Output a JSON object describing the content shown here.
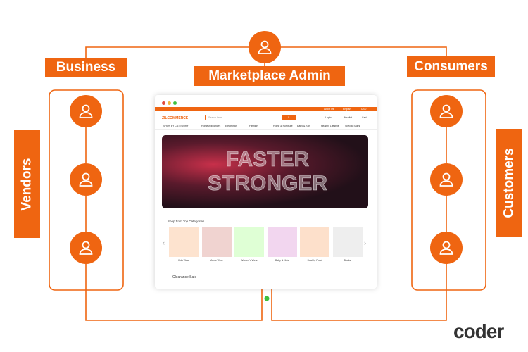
{
  "labels": {
    "business": "Business",
    "admin": "Marketplace Admin",
    "consumers": "Consumers",
    "vendors": "Vendors",
    "customers": "Customers"
  },
  "icons": {
    "user": "user-icon"
  },
  "colors": {
    "accent": "#ef6511"
  },
  "store": {
    "logo": "ZILCOMMERCE",
    "topbar": [
      "About Us",
      "English",
      "USD"
    ],
    "search_placeholder": "Search here...",
    "header_icons": [
      "Login",
      "Wishlist",
      "Cart"
    ],
    "all_categories": "SHOP BY CATEGORY",
    "nav": [
      "Home Appliances",
      "Electronics",
      "Fashion",
      "Home & Furniture",
      "Baby & Kids",
      "Healthy Lifestyle",
      "Special Sales"
    ],
    "banner_text": "FASTER STRONGER",
    "section_title": "Shop from Top Categories",
    "categories": [
      "Kids Wear",
      "Men's Wear",
      "Women's Wear",
      "Baby & Kids",
      "Healthy Food",
      "Books"
    ],
    "clearance": "Clearance Sale"
  },
  "brand": {
    "logo": "coder"
  }
}
